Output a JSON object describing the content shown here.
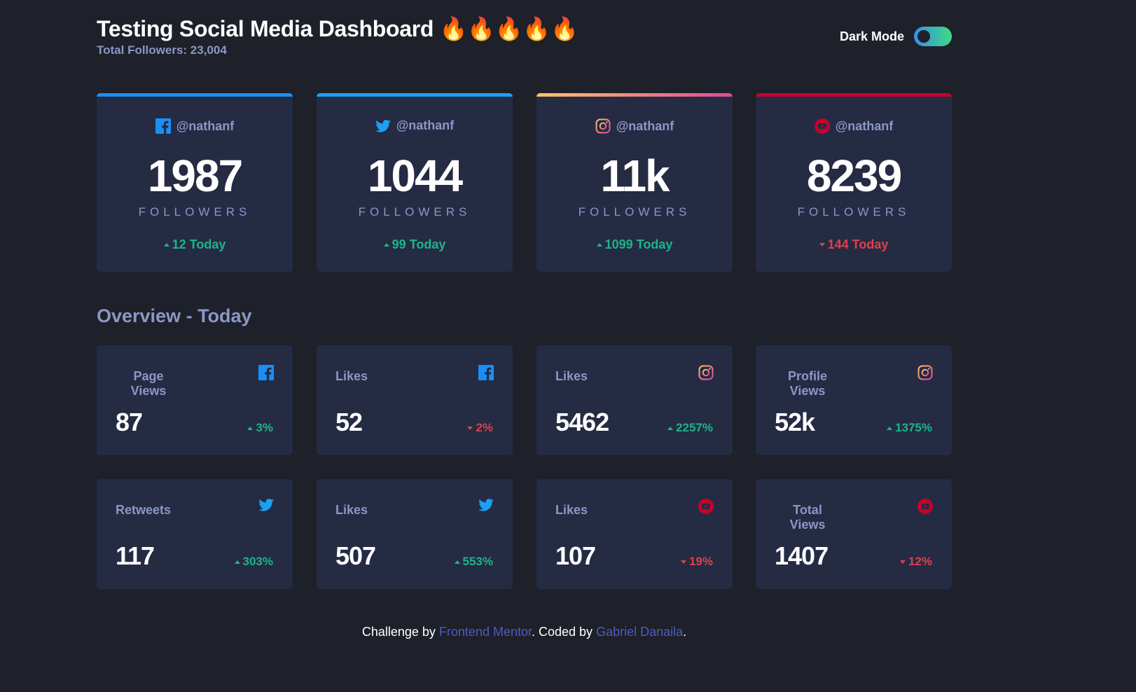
{
  "header": {
    "title": "Testing Social Media Dashboard 🔥🔥🔥🔥🔥",
    "total_followers": "Total Followers: 23,004",
    "dark_mode_label": "Dark Mode",
    "dark_mode_on": true
  },
  "colors": {
    "background": "#1e202a",
    "card": "#252b43",
    "muted_text": "#8b97c6",
    "up": "#1db489",
    "down": "#dc414c",
    "facebook": "#198ff5",
    "twitter": "#1ca0f2",
    "instagram_gradient": [
      "#fdc468",
      "#df4996"
    ],
    "youtube": "#c4032a",
    "link": "#4c5cc0"
  },
  "followers": [
    {
      "network": "facebook",
      "icon": "facebook-icon",
      "handle": "@nathanf",
      "count": "1987",
      "unit": "FOLLOWERS",
      "today": "12 Today",
      "trend": "up"
    },
    {
      "network": "twitter",
      "icon": "twitter-icon",
      "handle": "@nathanf",
      "count": "1044",
      "unit": "FOLLOWERS",
      "today": "99 Today",
      "trend": "up"
    },
    {
      "network": "instagram",
      "icon": "instagram-icon",
      "handle": "@nathanf",
      "count": "11k",
      "unit": "FOLLOWERS",
      "today": "1099 Today",
      "trend": "up"
    },
    {
      "network": "youtube",
      "icon": "youtube-icon",
      "handle": "@nathanf",
      "count": "8239",
      "unit": "FOLLOWERS",
      "today": "144 Today",
      "trend": "down"
    }
  ],
  "overview": {
    "title": "Overview - Today",
    "cards": [
      {
        "label": "Page Views",
        "icon": "facebook-icon",
        "value": "87",
        "percent": "3%",
        "trend": "up"
      },
      {
        "label": "Likes",
        "icon": "facebook-icon",
        "value": "52",
        "percent": "2%",
        "trend": "down"
      },
      {
        "label": "Likes",
        "icon": "instagram-icon",
        "value": "5462",
        "percent": "2257%",
        "trend": "up"
      },
      {
        "label": "Profile Views",
        "icon": "instagram-icon",
        "value": "52k",
        "percent": "1375%",
        "trend": "up"
      },
      {
        "label": "Retweets",
        "icon": "twitter-icon",
        "value": "117",
        "percent": "303%",
        "trend": "up"
      },
      {
        "label": "Likes",
        "icon": "twitter-icon",
        "value": "507",
        "percent": "553%",
        "trend": "up"
      },
      {
        "label": "Likes",
        "icon": "youtube-icon",
        "value": "107",
        "percent": "19%",
        "trend": "down"
      },
      {
        "label": "Total Views",
        "icon": "youtube-icon",
        "value": "1407",
        "percent": "12%",
        "trend": "down"
      }
    ]
  },
  "footer": {
    "prefix": "Challenge by ",
    "link1": "Frontend Mentor",
    "middle": ". Coded by ",
    "link2": "Gabriel Danaila",
    "suffix": "."
  }
}
